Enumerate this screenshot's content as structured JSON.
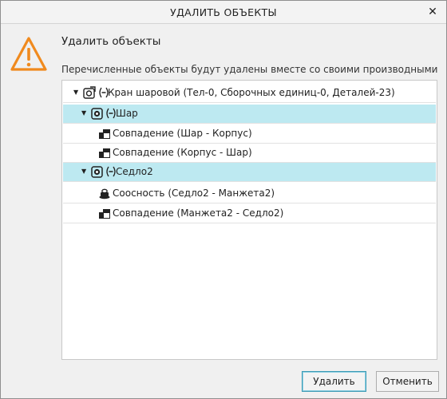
{
  "window": {
    "title": "УДАЛИТЬ ОБЪЕКТЫ",
    "close_glyph": "✕"
  },
  "heading": "Удалить объекты",
  "description": "Перечисленные объекты будут удалены вместе со своими производными",
  "tree": [
    {
      "label": "Кран шаровой (Тел-0, Сборочных единиц-0, Деталей-23)",
      "icon": "assembly-icon",
      "expanded": true,
      "selected": false
    },
    {
      "label": "Шар",
      "icon": "part-icon",
      "expanded": true,
      "selected": true
    },
    {
      "label": "Совпадение (Шар  -  Корпус)",
      "icon": "coincidence-constraint-icon",
      "selected": false
    },
    {
      "label": "Совпадение (Корпус  -  Шар)",
      "icon": "coincidence-constraint-icon",
      "selected": false
    },
    {
      "label": "Седло2",
      "icon": "part-icon",
      "expanded": true,
      "selected": true
    },
    {
      "label": "Соосность (Седло2  -  Манжета2)",
      "icon": "concentric-constraint-icon",
      "selected": false
    },
    {
      "label": "Совпадение (Манжета2  -  Седло2)",
      "icon": "coincidence-constraint-icon",
      "selected": false
    }
  ],
  "buttons": {
    "delete": "Удалить",
    "cancel": "Отменить"
  },
  "colors": {
    "warning": "#f08a1e",
    "selection": "#bde9f1",
    "primary_border": "#3c9ab5"
  }
}
